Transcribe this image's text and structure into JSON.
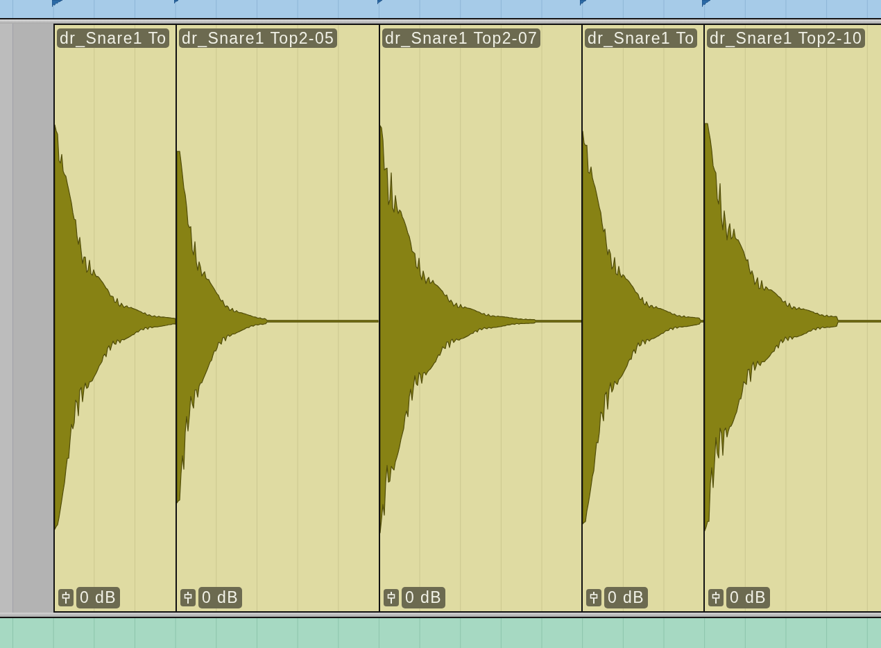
{
  "regions": [
    {
      "name": "dr_Snare1 To",
      "gain": "0 dB"
    },
    {
      "name": "dr_Snare1 Top2-05",
      "gain": "0 dB"
    },
    {
      "name": "dr_Snare1 Top2-07",
      "gain": "0 dB"
    },
    {
      "name": "dr_Snare1 To",
      "gain": "0 dB"
    },
    {
      "name": "dr_Snare1 Top2-10",
      "gain": "0 dB"
    }
  ]
}
